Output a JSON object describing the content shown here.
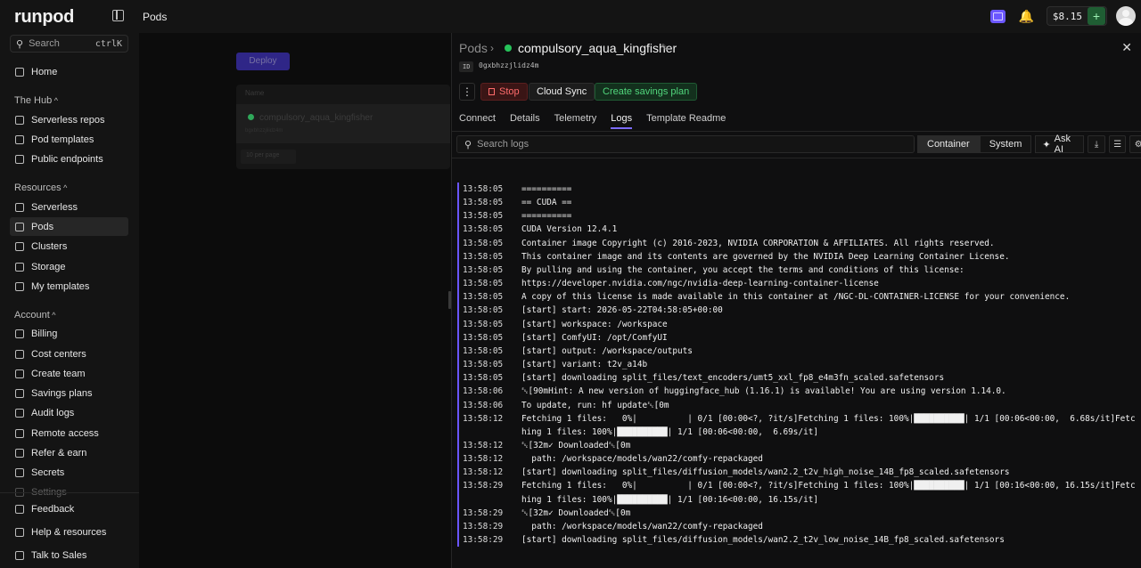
{
  "app": {
    "name": "runpod",
    "breadcrumb": "Pods"
  },
  "topbar": {
    "balance": "$8.15",
    "add_label": "+",
    "icons": [
      "ai-icon",
      "bell-icon",
      "avatar"
    ]
  },
  "sidebar": {
    "search": {
      "placeholder": "Search",
      "shortcut": "ctrlK"
    },
    "home": "Home",
    "hub": {
      "title": "The Hub",
      "items": [
        "Serverless repos",
        "Pod templates",
        "Public endpoints"
      ]
    },
    "resources": {
      "title": "Resources",
      "items": [
        "Serverless",
        "Pods",
        "Clusters",
        "Storage",
        "My templates"
      ]
    },
    "account": {
      "title": "Account",
      "items": [
        "Billing",
        "Cost centers",
        "Create team",
        "Savings plans",
        "Audit logs",
        "Remote access",
        "Refer & earn",
        "Secrets",
        "Settings"
      ]
    },
    "footer": [
      "Feedback",
      "Help & resources",
      "Talk to Sales"
    ],
    "active": "Pods"
  },
  "background": {
    "deploy_label": "Deploy",
    "list_header": "Name",
    "row_name": "compulsory_aqua_kingfisher",
    "row_sub": "bgxbhzzjliidz4m",
    "pager": "10 per page"
  },
  "detail": {
    "breadcrumb_root": "Pods",
    "pod_name": "compulsory_aqua_kingfisher",
    "status_color": "#26c35a",
    "id_label": "ID",
    "id_value": "0gxbhzzjlidz4m",
    "actions": {
      "stop": "Stop",
      "cloud_sync": "Cloud Sync",
      "savings": "Create savings plan"
    },
    "tabs": [
      "Connect",
      "Details",
      "Telemetry",
      "Logs",
      "Template Readme"
    ],
    "active_tab": "Logs",
    "log_search_placeholder": "Search logs",
    "log_tabs": [
      "Container",
      "System"
    ],
    "active_log_tab": "Container",
    "ask_ai": "Ask AI"
  },
  "logs": [
    {
      "ts": "13:58:05",
      "msg": "=========="
    },
    {
      "ts": "13:58:05",
      "msg": "== CUDA =="
    },
    {
      "ts": "13:58:05",
      "msg": "=========="
    },
    {
      "ts": "13:58:05",
      "msg": "CUDA Version 12.4.1"
    },
    {
      "ts": "13:58:05",
      "msg": "Container image Copyright (c) 2016-2023, NVIDIA CORPORATION & AFFILIATES. All rights reserved."
    },
    {
      "ts": "13:58:05",
      "msg": "This container image and its contents are governed by the NVIDIA Deep Learning Container License."
    },
    {
      "ts": "13:58:05",
      "msg": "By pulling and using the container, you accept the terms and conditions of this license:"
    },
    {
      "ts": "13:58:05",
      "msg": "https://developer.nvidia.com/ngc/nvidia-deep-learning-container-license"
    },
    {
      "ts": "13:58:05",
      "msg": "A copy of this license is made available in this container at /NGC-DL-CONTAINER-LICENSE for your convenience."
    },
    {
      "ts": "13:58:05",
      "msg": "[start] start: 2026-05-22T04:58:05+00:00"
    },
    {
      "ts": "13:58:05",
      "msg": "[start] workspace: /workspace"
    },
    {
      "ts": "13:58:05",
      "msg": "[start] ComfyUI: /opt/ComfyUI"
    },
    {
      "ts": "13:58:05",
      "msg": "[start] output: /workspace/outputs"
    },
    {
      "ts": "13:58:05",
      "msg": "[start] variant: t2v_a14b"
    },
    {
      "ts": "13:58:05",
      "msg": "[start] downloading split_files/text_encoders/umt5_xxl_fp8_e4m3fn_scaled.safetensors"
    },
    {
      "ts": "13:58:06",
      "msg": "␛[90mHint: A new version of huggingface_hub (1.16.1) is available! You are using version 1.14.0."
    },
    {
      "ts": "13:58:06",
      "msg": "To update, run: hf update␛[0m"
    },
    {
      "ts": "13:58:12",
      "msg": "Fetching 1 files:   0%|          | 0/1 [00:00<?, ?it/s]Fetching 1 files: 100%|██████████| 1/1 [00:06<00:00,  6.68s/it]Fetching 1 files: 100%|██████████| 1/1 [00:06<00:00,  6.69s/it]"
    },
    {
      "ts": "13:58:12",
      "msg": "␛[32m✓ Downloaded␛[0m"
    },
    {
      "ts": "13:58:12",
      "msg": "  path: /workspace/models/wan22/comfy-repackaged"
    },
    {
      "ts": "13:58:12",
      "msg": "[start] downloading split_files/diffusion_models/wan2.2_t2v_high_noise_14B_fp8_scaled.safetensors"
    },
    {
      "ts": "13:58:29",
      "msg": "Fetching 1 files:   0%|          | 0/1 [00:00<?, ?it/s]Fetching 1 files: 100%|██████████| 1/1 [00:16<00:00, 16.15s/it]Fetching 1 files: 100%|██████████| 1/1 [00:16<00:00, 16.15s/it]"
    },
    {
      "ts": "13:58:29",
      "msg": "␛[32m✓ Downloaded␛[0m"
    },
    {
      "ts": "13:58:29",
      "msg": "  path: /workspace/models/wan22/comfy-repackaged"
    },
    {
      "ts": "13:58:29",
      "msg": "[start] downloading split_files/diffusion_models/wan2.2_t2v_low_noise_14B_fp8_scaled.safetensors"
    }
  ]
}
